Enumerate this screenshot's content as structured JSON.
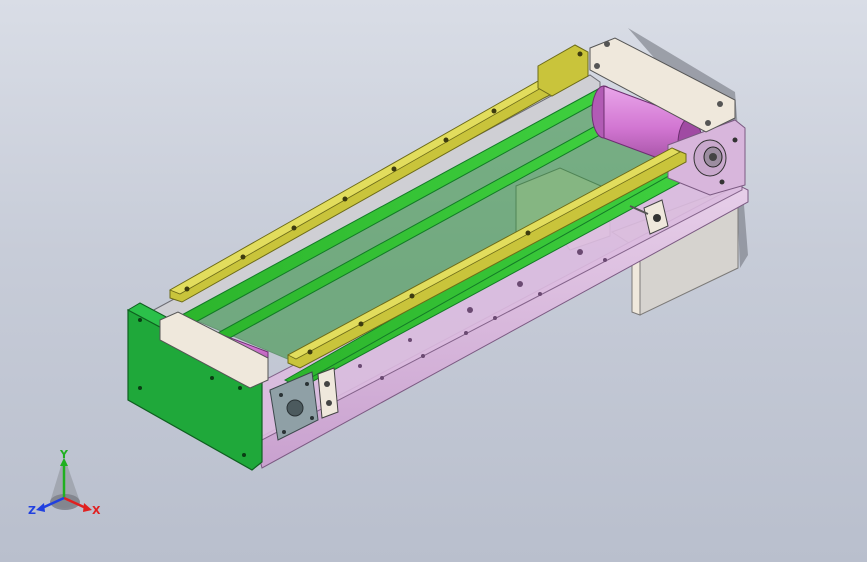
{
  "viewport": {
    "background_top": "#d9dde6",
    "background_bottom": "#b9bfcd"
  },
  "colors": {
    "green_plate": "#1fa83a",
    "green_dark": "#137a27",
    "belt_green": "#2fbf2f",
    "yellow_rail": "#c9c43b",
    "yellow_dark": "#8c8a22",
    "roller_magenta": "#d276d2",
    "roller_dark": "#9a4a9a",
    "frame_lavender": "#d8b6dc",
    "frame_edge": "#7b5a82",
    "beige_block": "#efe8dc",
    "grey_panel": "#d6d3cf",
    "axis_x": "#e02020",
    "axis_y": "#20b020",
    "axis_z": "#2040e0"
  },
  "triad": {
    "x_label": "X",
    "y_label": "Y",
    "z_label": "Z"
  }
}
